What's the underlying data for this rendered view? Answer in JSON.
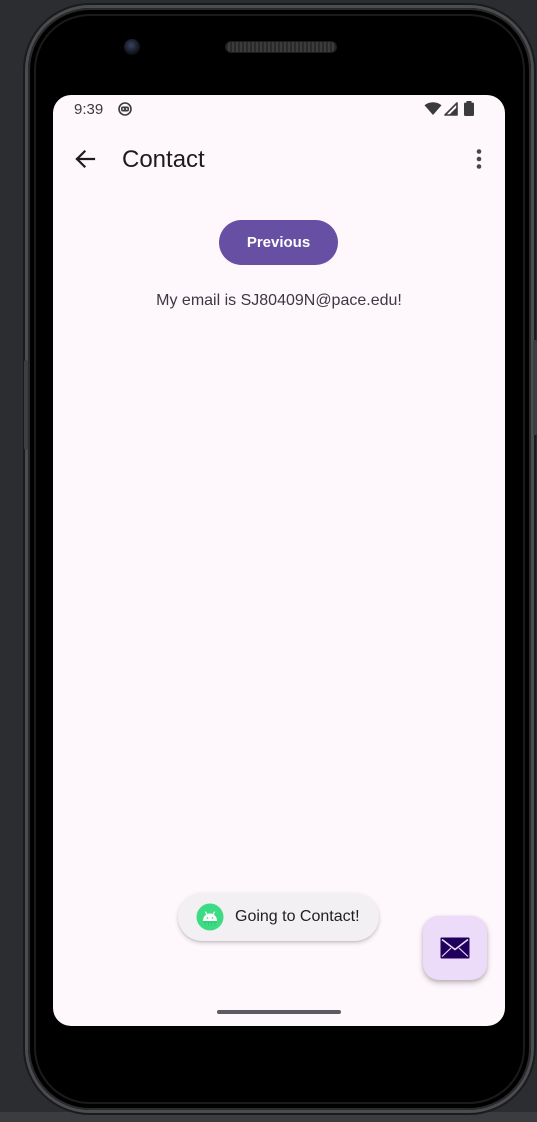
{
  "status_bar": {
    "time": "9:39",
    "app_icon": "android-face-icon",
    "icons": [
      "wifi-icon",
      "signal-icon",
      "battery-icon"
    ]
  },
  "app_bar": {
    "title": "Contact",
    "back_icon": "arrow-back-icon",
    "menu_icon": "more-vert-icon"
  },
  "content": {
    "previous_label": "Previous",
    "email_text": "My email is SJ80409N@pace.edu!"
  },
  "toast": {
    "message": "Going to Contact!",
    "icon": "android-icon"
  },
  "fab": {
    "icon": "mail-icon"
  },
  "colors": {
    "primary": "#6750a4",
    "background": "#fef7fc",
    "fab_container": "#ecdcf9",
    "on_fab": "#21005d"
  }
}
